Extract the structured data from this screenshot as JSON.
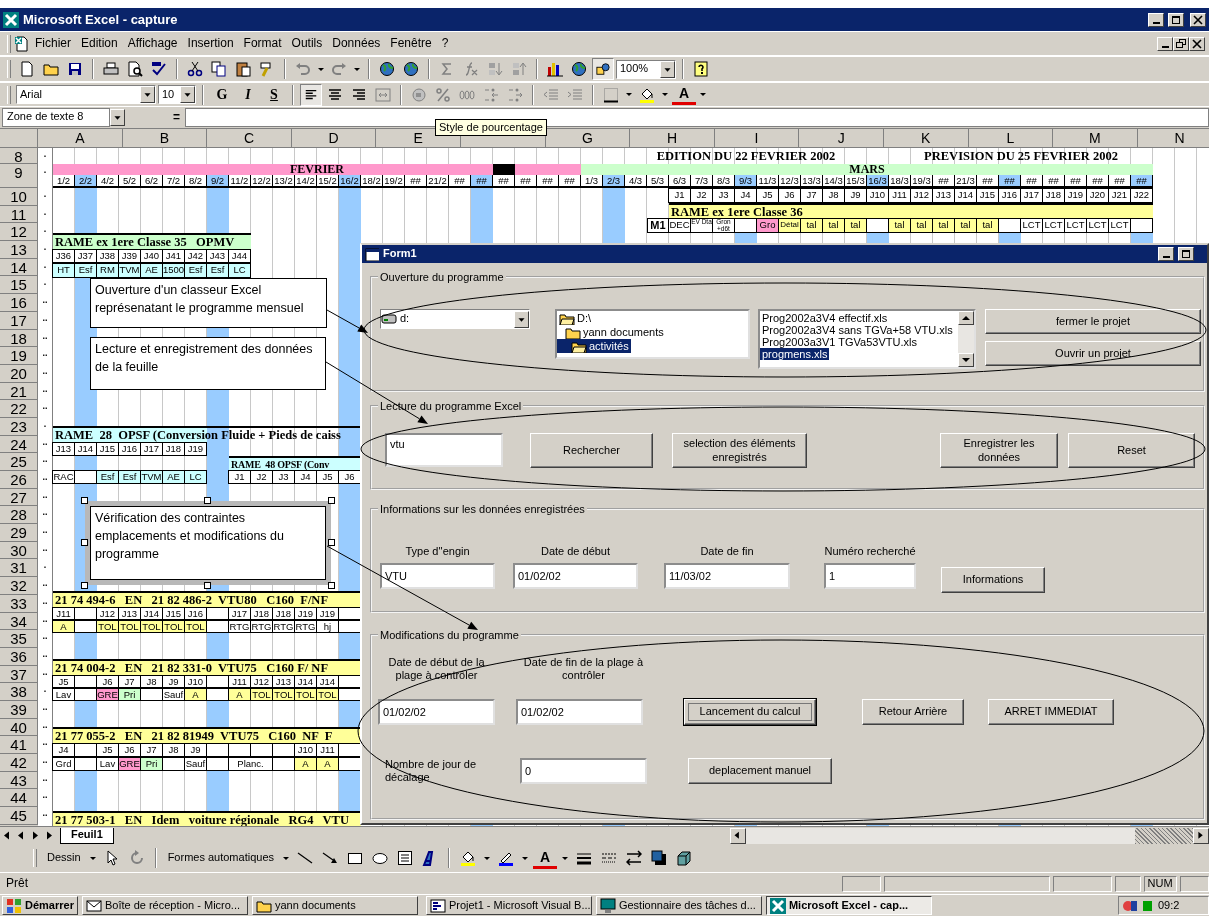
{
  "window": {
    "title": "Microsoft Excel - capture"
  },
  "menu": [
    "Fichier",
    "Edition",
    "Affichage",
    "Insertion",
    "Format",
    "Outils",
    "Données",
    "Fenêtre",
    "?"
  ],
  "standard_toolbar": {
    "zoom": "100%",
    "drawing_pressed": true
  },
  "format_toolbar": {
    "font": "Arial",
    "size": "10",
    "bold": "G",
    "italic": "I",
    "underline": "S",
    "align_left_pressed": true,
    "font_color_glyph": "A"
  },
  "formula_bar": {
    "name_box": "Zone de texte 8",
    "equals": "="
  },
  "tooltip": "Style de pourcentage",
  "sheet": {
    "column_headers": [
      "A",
      "B",
      "C",
      "D",
      "E",
      "G",
      "H",
      "I",
      "J",
      "K",
      "L",
      "M",
      "N"
    ],
    "rows": [
      {
        "number": "8",
        "outline": "."
      },
      {
        "number": "9",
        "outline": "."
      },
      {
        "number": "10",
        "outline": "."
      },
      {
        "number": "11",
        "outline": "."
      },
      {
        "number": "12",
        "outline": "."
      },
      {
        "number": "13",
        "outline": "."
      },
      {
        "number": "14",
        "outline": "."
      },
      {
        "number": "15",
        "outline": "."
      },
      {
        "number": "16",
        "outline": ".."
      },
      {
        "number": "17",
        "outline": ".."
      },
      {
        "number": "18",
        "outline": ".."
      },
      {
        "number": "19",
        "outline": ".."
      },
      {
        "number": "20",
        "outline": ".."
      },
      {
        "number": "21",
        "outline": ".."
      },
      {
        "number": "22",
        "outline": ".."
      },
      {
        "number": "23",
        "outline": "."
      },
      {
        "number": "24",
        "outline": ".."
      },
      {
        "number": "25",
        "outline": ".."
      },
      {
        "number": "26",
        "outline": ".."
      },
      {
        "number": "27",
        "outline": ".."
      },
      {
        "number": "28",
        "outline": ".."
      },
      {
        "number": "29",
        "outline": ".."
      },
      {
        "number": "30",
        "outline": ".."
      },
      {
        "number": "31",
        "outline": "."
      },
      {
        "number": "32",
        "outline": ".."
      },
      {
        "number": "33",
        "outline": ".."
      },
      {
        "number": "34",
        "outline": ".."
      },
      {
        "number": "35",
        "outline": ".."
      },
      {
        "number": "36",
        "outline": ".."
      },
      {
        "number": "37",
        "outline": ".."
      },
      {
        "number": "38",
        "outline": "."
      },
      {
        "number": "39",
        "outline": ".."
      },
      {
        "number": "40",
        "outline": ".."
      },
      {
        "number": "41",
        "outline": ".."
      },
      {
        "number": "42",
        "outline": ".."
      },
      {
        "number": "43",
        "outline": ".."
      },
      {
        "number": "44",
        "outline": ".."
      },
      {
        "number": "45",
        "outline": ".."
      }
    ],
    "edition": "EDITION DU 22 FEVRIER 2002",
    "prevision": "PREVISION DU 25 FEVRIER 2002",
    "months": [
      {
        "label": "FEVRIER"
      },
      {
        "label": "MARS"
      }
    ],
    "dates": [
      {
        "label": "1/2",
        "highlighted": false
      },
      {
        "label": "2/2",
        "highlighted": true
      },
      {
        "label": "4/2",
        "highlighted": false
      },
      {
        "label": "5/2",
        "highlighted": false
      },
      {
        "label": "6/2",
        "highlighted": false
      },
      {
        "label": "7/2",
        "highlighted": false
      },
      {
        "label": "8/2",
        "highlighted": false
      },
      {
        "label": "9/2",
        "highlighted": true
      },
      {
        "label": "11/2",
        "highlighted": false
      },
      {
        "label": "12/2",
        "highlighted": false
      },
      {
        "label": "13/2",
        "highlighted": false
      },
      {
        "label": "14/2",
        "highlighted": false
      },
      {
        "label": "15/2",
        "highlighted": false
      },
      {
        "label": "16/2",
        "highlighted": true
      },
      {
        "label": "18/2",
        "highlighted": false
      },
      {
        "label": "19/2",
        "highlighted": false
      },
      {
        "label": "##",
        "highlighted": false
      },
      {
        "label": "21/2",
        "highlighted": false
      },
      {
        "label": "##",
        "highlighted": false
      },
      {
        "label": "##",
        "highlighted": true
      },
      {
        "label": "##",
        "highlighted": false
      },
      {
        "label": "##",
        "highlighted": false
      },
      {
        "label": "##",
        "highlighted": false
      },
      {
        "label": "##",
        "highlighted": false
      },
      {
        "label": "1/3",
        "highlighted": false
      },
      {
        "label": "2/3",
        "highlighted": true
      },
      {
        "label": "4/3",
        "highlighted": false
      },
      {
        "label": "5/3",
        "highlighted": false
      },
      {
        "label": "6/3",
        "highlighted": false
      },
      {
        "label": "7/3",
        "highlighted": false
      },
      {
        "label": "8/3",
        "highlighted": false
      },
      {
        "label": "9/3",
        "highlighted": true
      },
      {
        "label": "11/3",
        "highlighted": false
      },
      {
        "label": "12/3",
        "highlighted": false
      },
      {
        "label": "13/3",
        "highlighted": false
      },
      {
        "label": "14/3",
        "highlighted": false
      },
      {
        "label": "15/3",
        "highlighted": false
      },
      {
        "label": "16/3",
        "highlighted": true
      },
      {
        "label": "18/3",
        "highlighted": false
      },
      {
        "label": "19/3",
        "highlighted": false
      },
      {
        "label": "##",
        "highlighted": false
      },
      {
        "label": "21/3",
        "highlighted": false
      },
      {
        "label": "##",
        "highlighted": false
      },
      {
        "label": "##",
        "highlighted": true
      },
      {
        "label": "##",
        "highlighted": false
      },
      {
        "label": "##",
        "highlighted": false
      },
      {
        "label": "##",
        "highlighted": false
      },
      {
        "label": "##",
        "highlighted": false
      },
      {
        "label": "##",
        "highlighted": false
      },
      {
        "label": "##",
        "highlighted": true
      }
    ],
    "blocks": [
      {
        "kind": "cells",
        "cells": [
          {
            "text": "J1"
          },
          {
            "text": "J2"
          },
          {
            "text": "J3"
          },
          {
            "text": "J4"
          },
          {
            "text": "J5"
          },
          {
            "text": "J6"
          },
          {
            "text": "J7"
          },
          {
            "text": "J8"
          },
          {
            "text": "J9"
          },
          {
            "text": "J10"
          },
          {
            "text": "J11"
          },
          {
            "text": "J12"
          },
          {
            "text": "J13"
          },
          {
            "text": "J14"
          },
          {
            "text": "J15"
          },
          {
            "text": "J16"
          },
          {
            "text": "J17"
          },
          {
            "text": "J18"
          },
          {
            "text": "J19"
          },
          {
            "text": "J20"
          },
          {
            "text": "J21"
          },
          {
            "text": "J22"
          }
        ]
      },
      {
        "kind": "title",
        "text": "RAME ex 1ere Classe 36",
        "color": "#ffff99"
      },
      {
        "kind": "cells",
        "label": "M1",
        "cells": [
          {
            "text": "DEC"
          },
          {
            "text": "EV Dta"
          },
          {
            "text": "Gron +d6t"
          },
          null,
          {
            "text": "Gro",
            "color": "#ff99cc"
          },
          {
            "text": "Détal",
            "color": "#ffff99"
          },
          {
            "text": "tal",
            "color": "#ffff99"
          },
          {
            "text": "tal",
            "color": "#ffff99"
          },
          {
            "text": "tal",
            "color": "#ffff99"
          },
          null,
          {
            "text": "tal",
            "color": "#ffff99"
          },
          {
            "text": "tal",
            "color": "#ffff99"
          },
          {
            "text": "tal",
            "color": "#ffff99"
          },
          {
            "text": "tal",
            "color": "#ffff99"
          },
          {
            "text": "tal",
            "color": "#ffff99"
          },
          null,
          {
            "text": "LCT"
          },
          {
            "text": "LCT"
          },
          {
            "text": "LCT"
          },
          {
            "text": "LCT"
          },
          {
            "text": "LCT"
          },
          null
        ]
      },
      {
        "kind": "title",
        "text": "RAME ex 1ere Classe 35   OPMV",
        "color": "#ccffcc"
      },
      {
        "kind": "cells",
        "cells": [
          {
            "text": "J36"
          },
          {
            "text": "J37"
          },
          {
            "text": "J38"
          },
          {
            "text": "J39"
          },
          {
            "text": "J40"
          },
          {
            "text": "J41"
          },
          {
            "text": "J42"
          },
          {
            "text": "J43"
          },
          {
            "text": "J44"
          }
        ]
      },
      {
        "kind": "cells",
        "cells": [
          {
            "text": "HT",
            "color": "#ccffff"
          },
          {
            "text": "Esf",
            "color": "#ccffff"
          },
          {
            "text": "RM",
            "color": "#ccffff"
          },
          {
            "text": "TVM",
            "color": "#ccffff"
          },
          {
            "text": "AE",
            "color": "#ccffff"
          },
          {
            "text": "1500",
            "color": "#ccffff"
          },
          {
            "text": "Esf",
            "color": "#ccffff"
          },
          {
            "text": "Esf",
            "color": "#ccffff"
          },
          {
            "text": "LC",
            "color": "#ccffff"
          }
        ]
      },
      {
        "kind": "title",
        "text": "RAME  28  OPSF (Conversion Fluide + Pieds de caiss",
        "color": "#ccffff"
      },
      {
        "kind": "cells",
        "cells": [
          {
            "text": "J13"
          },
          {
            "text": "J14"
          },
          {
            "text": "J15"
          },
          {
            "text": "J16"
          },
          {
            "text": "J17"
          },
          {
            "text": "J18"
          },
          {
            "text": "J19"
          }
        ]
      },
      {
        "kind": "title",
        "text": "RAME  48 OPSF (Conv",
        "color": "#ccffff"
      },
      {
        "kind": "cells",
        "cells": [
          {
            "text": "RAC"
          },
          null,
          {
            "text": "Esf",
            "color": "#ccffff"
          },
          {
            "text": "Esf",
            "color": "#ccffff"
          },
          {
            "text": "TVM",
            "color": "#ccffff"
          },
          {
            "text": "AE",
            "color": "#ccffff"
          },
          {
            "text": "LC",
            "color": "#ccffff"
          }
        ]
      },
      {
        "kind": "cells",
        "cells": [
          {
            "text": "J1"
          },
          {
            "text": "J2"
          },
          {
            "text": "J3"
          },
          {
            "text": "J4"
          },
          {
            "text": "J5"
          },
          {
            "text": "J6"
          }
        ]
      },
      {
        "kind": "title",
        "text": "21 74 494-6   EN   21 82 486-2  VTU80   C160  F/NF",
        "color": "#ffff99"
      },
      {
        "kind": "cells",
        "cells": [
          {
            "text": "J11"
          },
          null,
          {
            "text": "J12"
          },
          {
            "text": "J13"
          },
          {
            "text": "J14"
          },
          {
            "text": "J15"
          },
          {
            "text": "J16"
          },
          null,
          {
            "text": "J17"
          },
          {
            "text": "J18"
          },
          {
            "text": "J18"
          },
          {
            "text": "J19"
          },
          {
            "text": "J19"
          },
          null
        ]
      },
      {
        "kind": "cells",
        "cells": [
          {
            "text": "A",
            "color": "#ffff99"
          },
          null,
          {
            "text": "TOL",
            "color": "#ffff99"
          },
          {
            "text": "TOL",
            "color": "#ffff99"
          },
          {
            "text": "TOL",
            "color": "#ffff99"
          },
          {
            "text": "TOL",
            "color": "#ffff99"
          },
          {
            "text": "TOL",
            "color": "#ffff99"
          },
          null,
          {
            "text": "RTG"
          },
          {
            "text": "RTG"
          },
          {
            "text": "RTG"
          },
          {
            "text": "RTG"
          },
          {
            "text": "hj"
          },
          null
        ]
      },
      {
        "kind": "title",
        "text": "21 74 004-2   EN   21 82 331-0  VTU75   C160 F/ NF",
        "color": "#ffff99"
      },
      {
        "kind": "cells",
        "cells": [
          {
            "text": "J5"
          },
          null,
          {
            "text": "J6"
          },
          {
            "text": "J7"
          },
          {
            "text": "J8"
          },
          {
            "text": "J9"
          },
          {
            "text": "J10"
          },
          null,
          {
            "text": "J11"
          },
          {
            "text": "J12"
          },
          {
            "text": "J13"
          },
          {
            "text": "J14"
          },
          {
            "text": "J14"
          },
          null
        ]
      },
      {
        "kind": "cells",
        "cells": [
          {
            "text": "Lav"
          },
          null,
          {
            "text": "GRE",
            "color": "#ff99cc"
          },
          {
            "text": "Pri",
            "color": "#ccffcc"
          },
          null,
          {
            "text": "Sauf"
          },
          {
            "text": "A",
            "color": "#ffff99"
          },
          null,
          {
            "text": "A",
            "color": "#ffff99"
          },
          {
            "text": "TOL",
            "color": "#ffff99"
          },
          {
            "text": "TOL",
            "color": "#ffff99"
          },
          {
            "text": "TOL",
            "color": "#ffff99"
          },
          {
            "text": "TOL",
            "color": "#ffff99"
          },
          null
        ]
      },
      {
        "kind": "title",
        "text": "21 77 055-2   EN   21 82 81949  VTU75   C160  NF  F",
        "color": "#ffff99"
      },
      {
        "kind": "cells",
        "cells": [
          {
            "text": "J4"
          },
          null,
          {
            "text": "J5"
          },
          {
            "text": "J6"
          },
          {
            "text": "J7"
          },
          {
            "text": "J8"
          },
          {
            "text": "J9"
          },
          null,
          null,
          null,
          null,
          {
            "text": "J10"
          },
          {
            "text": "J11"
          },
          null
        ]
      },
      {
        "kind": "cells",
        "cells": [
          {
            "text": "Grd"
          },
          null,
          {
            "text": "Lav"
          },
          {
            "text": "GRE",
            "color": "#ff99cc"
          },
          {
            "text": "Pri",
            "color": "#ccffcc"
          },
          null,
          {
            "text": "Sauf"
          },
          null,
          {
            "text": "Planc."
          },
          null,
          null,
          {
            "text": "A",
            "color": "#ffff99"
          },
          {
            "text": "A",
            "color": "#ffff99"
          },
          null
        ]
      },
      {
        "kind": "title",
        "text": "21 77 503-1   EN   Idem   voiture régionale   RG4   VTU",
        "color": "#ffff99"
      }
    ]
  },
  "callouts": [
    {
      "text": "Ouverture d'un classeur Excel représenatant le programme mensuel",
      "selected": false
    },
    {
      "text": "Lecture et enregistrement des données de la feuille",
      "selected": false
    },
    {
      "text": "Vérification des contraintes emplacements et modifications du programme",
      "selected": true
    }
  ],
  "form": {
    "title": "Form1",
    "groups": [
      {
        "kind": "open",
        "title": "Ouverture du programme",
        "drive": "d:",
        "folders": [
          {
            "label": "D:\\",
            "selected": false
          },
          {
            "label": "yann documents",
            "selected": false
          },
          {
            "label": "activités",
            "selected": true
          }
        ],
        "files": [
          {
            "label": "Prog2002a3V4 effectif.xls",
            "selected": false
          },
          {
            "label": "Prog2002a3V4 sans TGVa+58 VTU.xls",
            "selected": false
          },
          {
            "label": "Prog2003a3V1 TGVa53VTU.xls",
            "selected": false
          },
          {
            "label": "progmens.xls",
            "selected": true
          }
        ],
        "buttons": [
          "fermer le projet",
          "Ouvrir un projet"
        ]
      },
      {
        "kind": "read",
        "title": "Lecture du programme Excel",
        "search_value": "vtu",
        "buttons": [
          "Rechercher",
          "selection des éléments enregistrés",
          "Enregistrer les données",
          "Reset"
        ]
      },
      {
        "kind": "info",
        "title": "Informations sur les données enregistrées",
        "fields": [
          {
            "label": "Type d''engin",
            "value": "VTU"
          },
          {
            "label": "Date de début",
            "value": "01/02/02"
          },
          {
            "label": "Date de fin",
            "value": "11/03/02"
          },
          {
            "label": "Numéro recherché",
            "value": "1"
          }
        ],
        "button": "Informations"
      },
      {
        "kind": "modify",
        "title": "Modifications du programme",
        "fields": [
          {
            "label": "Date de début de la plage à contrôler",
            "value": "01/02/02"
          },
          {
            "label": "Date de fin de la plage à contrôler",
            "value": "01/02/02"
          },
          {
            "label": "Nombre de jour de décalage",
            "value": "0"
          }
        ],
        "buttons": [
          {
            "label": "Lancement du calcul",
            "default": true
          },
          {
            "label": "Retour Arrière",
            "default": false
          },
          {
            "label": "ARRET IMMEDIAT",
            "default": false
          },
          {
            "label": "deplacement manuel",
            "default": false
          }
        ]
      }
    ]
  },
  "sheet_tabs": [
    {
      "label": "Feuil1",
      "selected": true
    }
  ],
  "drawing_toolbar": {
    "draw_menu": "Dessin",
    "autoshapes_menu": "Formes automatiques",
    "font_color_glyph": "A"
  },
  "status_bar": {
    "text": "Prêt",
    "num_lock": "NUM"
  },
  "taskbar": {
    "start": "Démarrer",
    "items": [
      {
        "label": "Boîte de réception - Micro...",
        "active": false
      },
      {
        "label": "yann documents",
        "active": false
      },
      {
        "label": "Projet1 - Microsoft Visual B...",
        "active": false
      },
      {
        "label": "Gestionnaire des tâches d...",
        "active": false
      },
      {
        "label": "Microsoft Excel - cap...",
        "active": true
      }
    ],
    "clock": "09:2"
  }
}
